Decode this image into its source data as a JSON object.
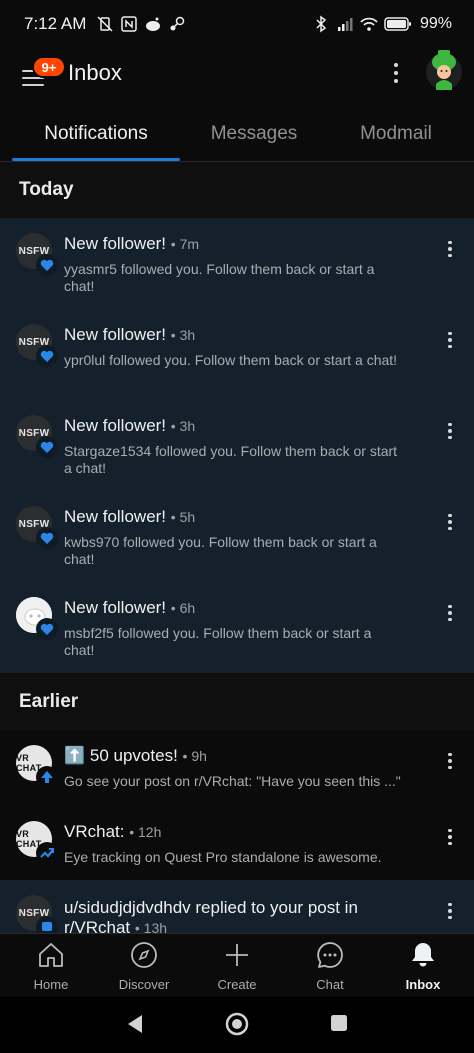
{
  "status_bar": {
    "time": "7:12 AM",
    "battery": "99%"
  },
  "header": {
    "title": "Inbox",
    "badge": "9+"
  },
  "tabs": [
    {
      "label": "Notifications",
      "active": true
    },
    {
      "label": "Messages",
      "active": false
    },
    {
      "label": "Modmail",
      "active": false
    }
  ],
  "sections": {
    "today": "Today",
    "earlier": "Earlier"
  },
  "today_items": [
    {
      "avatar": "NSFW",
      "title": "New follower!",
      "time": "• 7m",
      "body": "yyasmr5 followed you. Follow them back or start a chat!"
    },
    {
      "avatar": "NSFW",
      "title": "New follower!",
      "time": "• 3h",
      "body": "ypr0lul followed you. Follow them back or start a chat!"
    },
    {
      "avatar": "NSFW",
      "title": "New follower!",
      "time": "• 3h",
      "body": "Stargaze1534 followed you. Follow them back or start a chat!"
    },
    {
      "avatar": "NSFW",
      "title": "New follower!",
      "time": "• 5h",
      "body": "kwbs970 followed you. Follow them back or start a chat!"
    },
    {
      "avatar": "",
      "title": "New follower!",
      "time": "• 6h",
      "body": "msbf2f5 followed you. Follow them back or start a chat!"
    }
  ],
  "earlier_items": [
    {
      "avatar": "VR CHAT",
      "title": "⬆️ 50 upvotes!",
      "time": "• 9h",
      "body": "Go see your post on r/VRchat: \"Have you seen this ...\""
    },
    {
      "avatar": "VR CHAT",
      "title": "VRchat:",
      "time": "• 12h",
      "body": "Eye tracking on Quest Pro standalone is awesome."
    },
    {
      "avatar": "NSFW",
      "title": "u/sidudjdjdvdhdv replied to your post in",
      "title2": "r/VRchat",
      "time": "• 13h",
      "body": ""
    }
  ],
  "bottom_nav": [
    {
      "label": "Home",
      "icon": "home-icon"
    },
    {
      "label": "Discover",
      "icon": "compass-icon"
    },
    {
      "label": "Create",
      "icon": "plus-icon"
    },
    {
      "label": "Chat",
      "icon": "chat-icon"
    },
    {
      "label": "Inbox",
      "icon": "bell-icon",
      "active": true
    }
  ],
  "colors": {
    "accent": "#1f7ad8",
    "badge": "#ff4500",
    "unread_bg": "#14212c"
  }
}
